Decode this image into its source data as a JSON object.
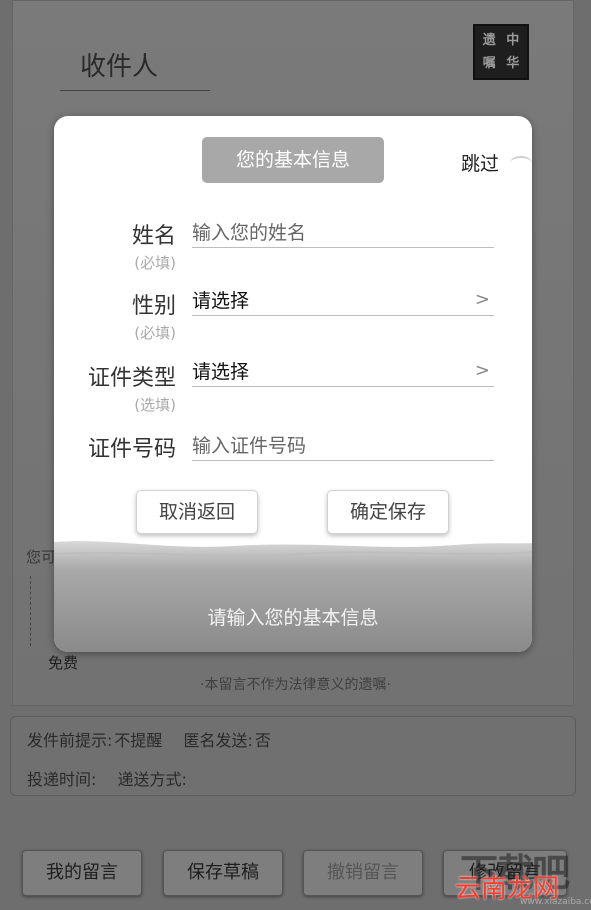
{
  "page": {
    "recipient_label": "收件人",
    "seal_chars": [
      "遗",
      "中",
      "嘱",
      "华"
    ],
    "bg_partial_text": "您可",
    "bg_free_label": "免费",
    "bg_disclaimer": "·本留言不作为法律意义的遗嘱·"
  },
  "info": {
    "reminder_label": "发件前提示:",
    "reminder_value": "不提醒",
    "anonymous_label": "匿名发送:",
    "anonymous_value": "否",
    "delivery_time_label": "投递时间:",
    "delivery_method_label": "递送方式:"
  },
  "bottom_buttons": {
    "my_messages": "我的留言",
    "save_draft": "保存草稿",
    "revoke": "撤销留言",
    "fourth": "修改留言"
  },
  "watermark": {
    "logo_text": "下载吧",
    "site_text": "云南龙网",
    "url": "www.xiazaiba.com"
  },
  "dialog": {
    "title": "您的基本信息",
    "skip": "跳过",
    "fields": [
      {
        "label": "姓名",
        "hint": "(必填)",
        "placeholder": "输入您的姓名",
        "value": ""
      },
      {
        "label": "性别",
        "hint": "(必填)",
        "placeholder": "",
        "value": "请选择",
        "chevron": ">"
      },
      {
        "label": "证件类型",
        "hint": "(选填)",
        "placeholder": "",
        "value": "请选择",
        "chevron": ">"
      },
      {
        "label": "证件号码",
        "hint": "",
        "placeholder": "输入证件号码",
        "value": ""
      }
    ],
    "cancel": "取消返回",
    "confirm": "确定保存",
    "footer_text": "请输入您的基本信息"
  }
}
